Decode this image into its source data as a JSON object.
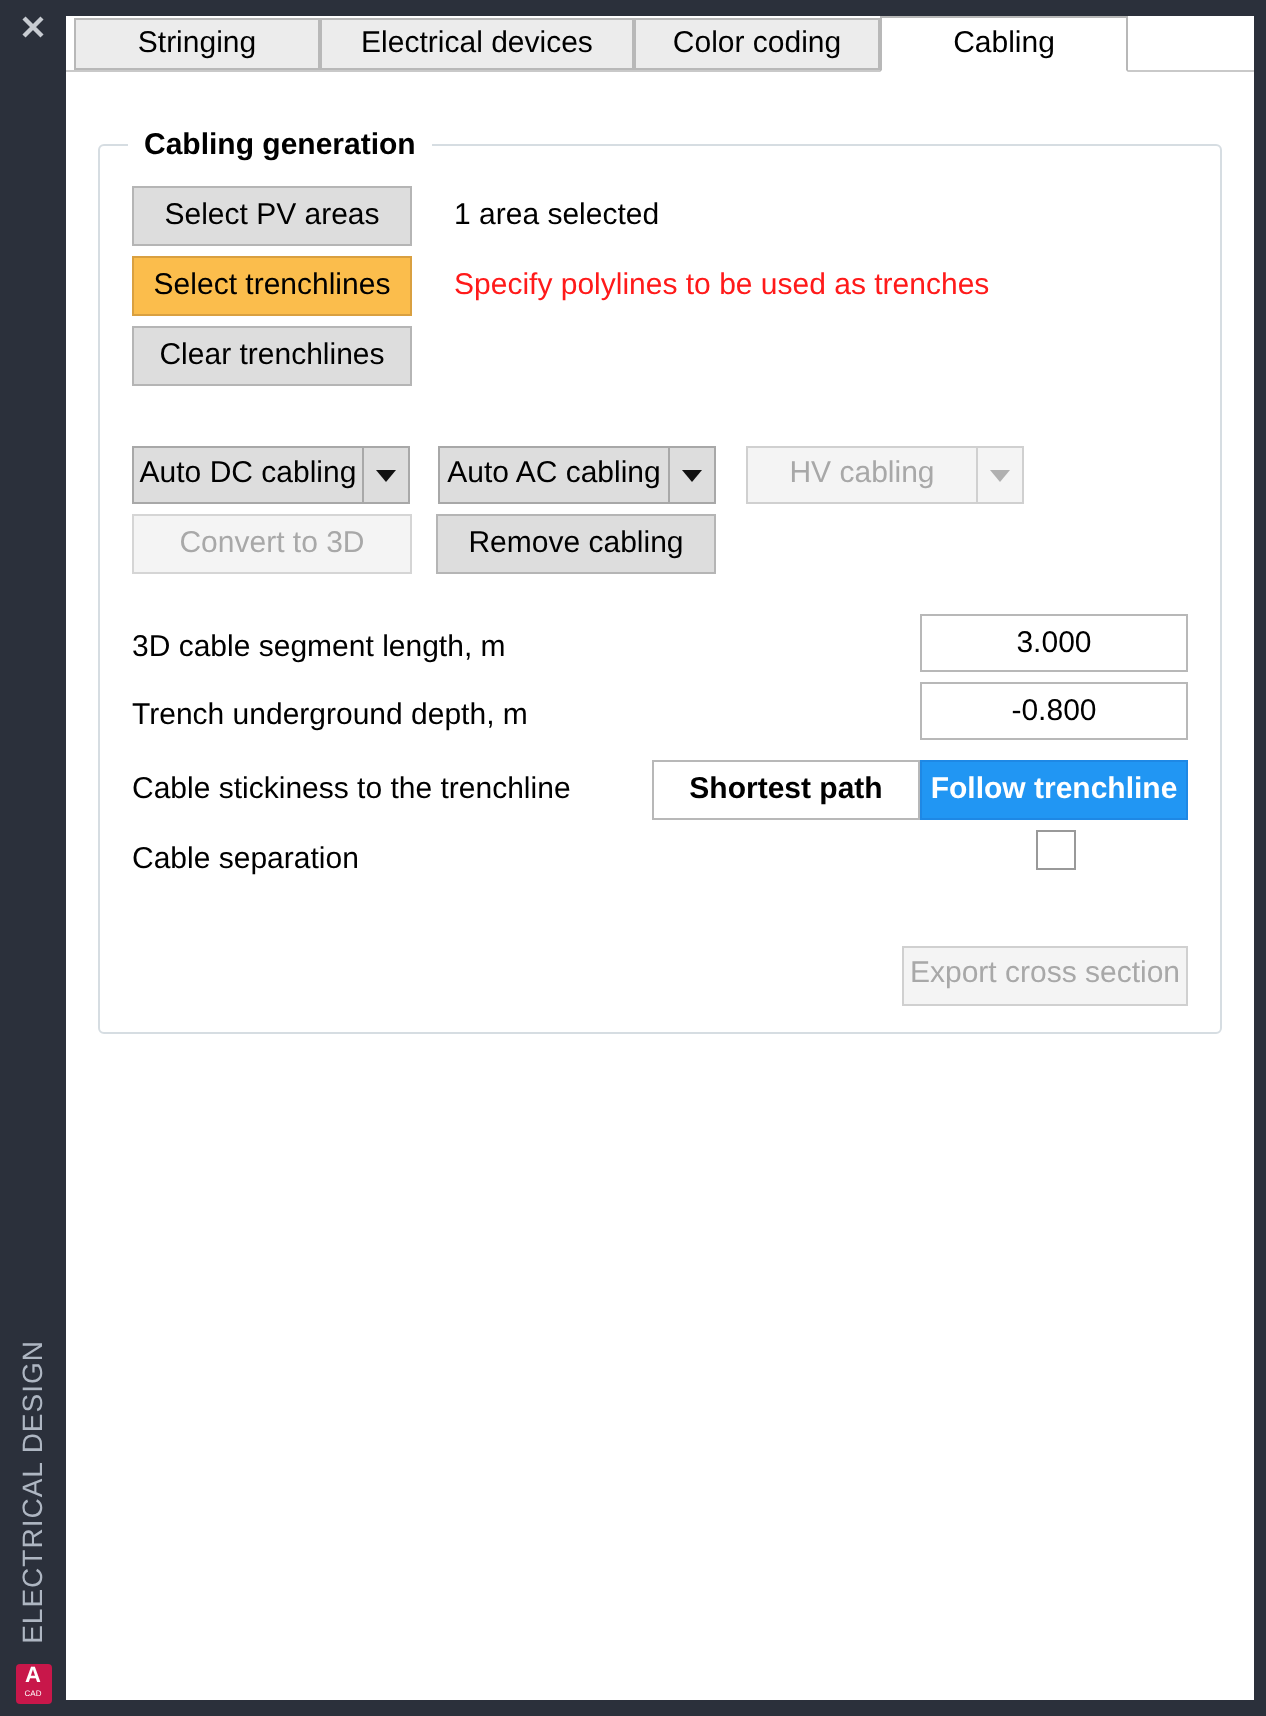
{
  "sidebar": {
    "title": "ELECTRICAL DESIGN",
    "logo": {
      "letter": "A",
      "caption": "CAD"
    }
  },
  "tabs": [
    {
      "label": "Stringing",
      "selected": false
    },
    {
      "label": "Electrical devices",
      "selected": false
    },
    {
      "label": "Color coding",
      "selected": false
    },
    {
      "label": "Cabling",
      "selected": true
    }
  ],
  "group": {
    "title": "Cabling generation",
    "selection_rows": [
      {
        "button": "Select PV areas",
        "highlighted": false,
        "status": "1 area selected",
        "kind": "info"
      },
      {
        "button": "Select trenchlines",
        "highlighted": true,
        "status": "Specify polylines to be used as trenches",
        "kind": "warning"
      },
      {
        "button": "Clear trenchlines",
        "highlighted": false
      }
    ],
    "split_buttons": [
      {
        "label": "Auto DC cabling",
        "disabled": false
      },
      {
        "label": "Auto AC cabling",
        "disabled": false
      },
      {
        "label": "HV cabling",
        "disabled": true
      }
    ],
    "action_buttons": [
      {
        "label": "Convert to 3D",
        "disabled": true
      },
      {
        "label": "Remove cabling",
        "disabled": false
      }
    ],
    "fields": [
      {
        "label": "3D cable segment length, m",
        "value": "3.000"
      },
      {
        "label": "Trench underground depth, m",
        "value": "-0.800"
      }
    ],
    "stickiness": {
      "label": "Cable stickiness to the trenchline",
      "options": [
        {
          "label": "Shortest path",
          "selected": false
        },
        {
          "label": "Follow trenchline",
          "selected": true
        }
      ]
    },
    "separation": {
      "label": "Cable separation",
      "checked": false
    },
    "export_button": {
      "label": "Export cross section",
      "disabled": true
    }
  }
}
